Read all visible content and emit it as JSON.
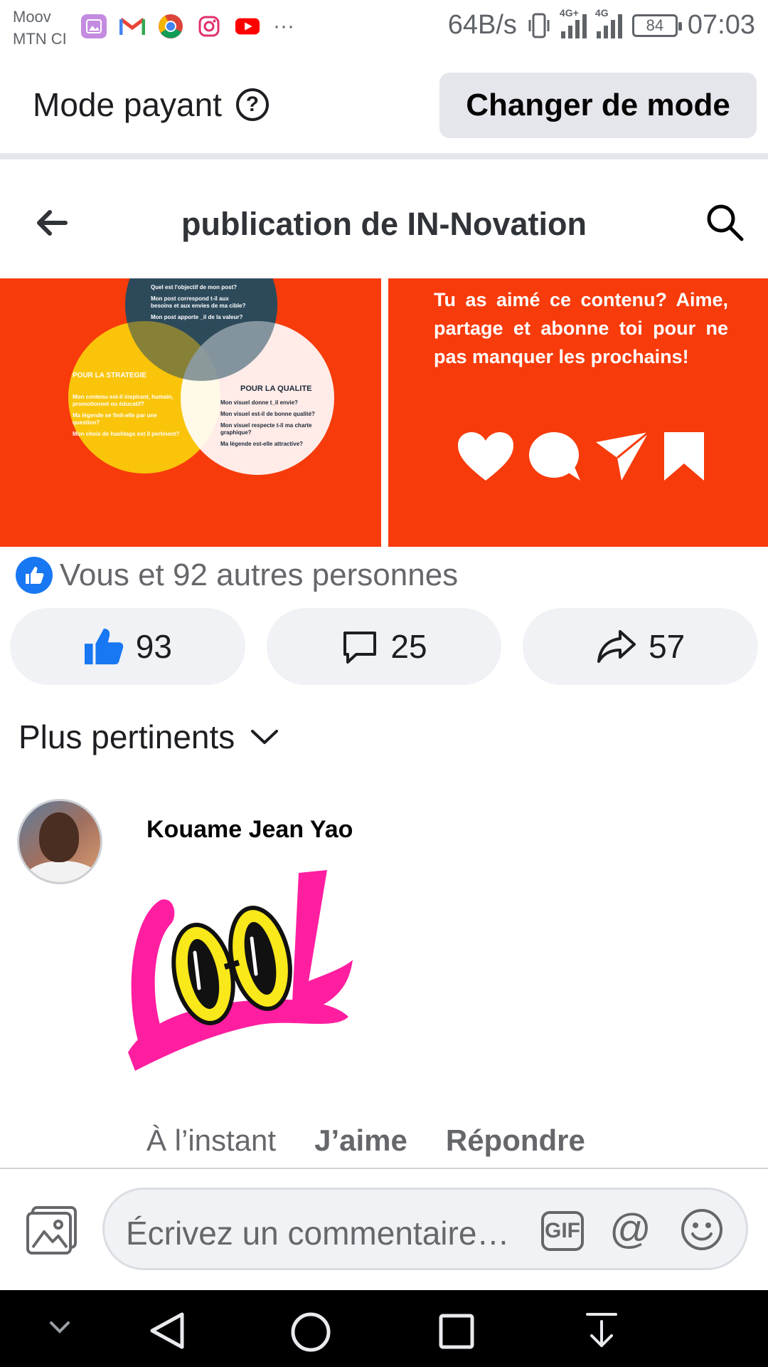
{
  "status_bar": {
    "carrier_line1": "Moov",
    "carrier_line2": "MTN CI",
    "more_indicator": "···",
    "net_speed": "64B/s",
    "network_label_1": "4G+",
    "network_label_2": "4G",
    "battery": "84",
    "time": "07:03",
    "app_icons": [
      "gallery-icon",
      "gmail-icon",
      "chrome-icon",
      "instagram-icon",
      "youtube-icon"
    ]
  },
  "mode_bar": {
    "label": "Mode payant",
    "help_icon": "?",
    "button": "Changer de mode"
  },
  "header": {
    "title": "publication de IN-Novation",
    "back_icon": "arrow-left-icon",
    "search_icon": "search-icon"
  },
  "post": {
    "left_image": {
      "top_question": "Quel est l'objectif de mon post?",
      "top_lines": [
        "Mon post correspond t-il aux",
        "besoins et aux envies de ma cible?",
        "Mon post apporte _il de la valeur?"
      ],
      "left_head": "POUR LA STRATEGIE",
      "left_lines": [
        "Mon contenu est-il inspirant, humain,",
        "promotionnel ou éducatif?",
        "Ma légende se finit-elle par une",
        "question?",
        "Mon choix de hashtags est il pertinent?"
      ],
      "right_head": "POUR LA QUALITE",
      "right_lines": [
        "Mon visuel donne t_il envie?",
        "Mon visuel est-il de bonne qualité?",
        "Mon visuel respecte t-il ma charte",
        "graphique?",
        "Ma légende est-elle attractive?"
      ]
    },
    "right_image": {
      "cta_text": "Tu as aimé ce contenu? Aime, partage et abonne toi pour ne pas manquer les prochains!",
      "icons": [
        "heart-icon",
        "comment-bubble-icon",
        "paper-plane-icon",
        "bookmark-icon"
      ]
    },
    "likers_text": "Vous et 92 autres personnes",
    "likes": "93",
    "comments": "25",
    "shares": "57"
  },
  "sort": {
    "label": "Plus pertinents"
  },
  "comment": {
    "author": "Kouame Jean Yao",
    "sticker_text": "COOL",
    "time": "À l’instant",
    "like": "J’aime",
    "reply": "Répondre"
  },
  "composer": {
    "placeholder": "Écrivez un commentaire…",
    "gif_label": "GIF",
    "at_label": "@"
  },
  "colors": {
    "brand_blue": "#1877f2",
    "post_orange": "#f73b0b",
    "pill_bg": "#f0f2f5",
    "secondary_text": "#65676b"
  }
}
